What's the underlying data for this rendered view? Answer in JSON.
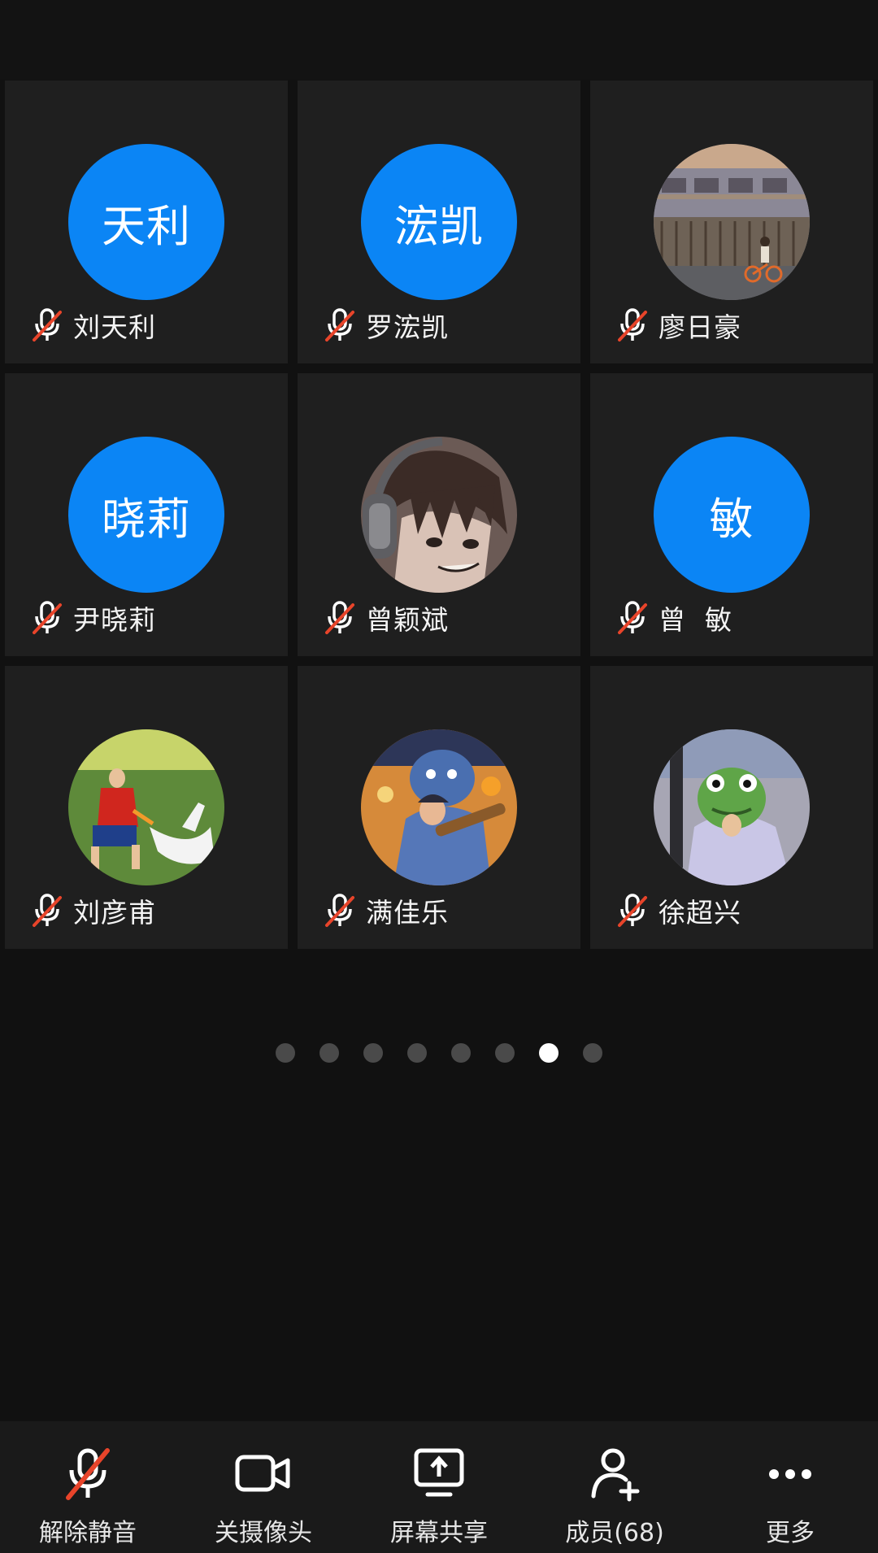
{
  "participants": [
    {
      "name": "刘天利",
      "avatar_text": "天利",
      "avatar_kind": "initials"
    },
    {
      "name": "罗浤凯",
      "avatar_text": "浤凯",
      "avatar_kind": "initials"
    },
    {
      "name": "廖日豪",
      "avatar_text": "",
      "avatar_kind": "photo-street"
    },
    {
      "name": "尹晓莉",
      "avatar_text": "晓莉",
      "avatar_kind": "initials"
    },
    {
      "name": "曾颖斌",
      "avatar_text": "",
      "avatar_kind": "photo-anime-headphones"
    },
    {
      "name": "曾  敏",
      "avatar_text": "敏",
      "avatar_kind": "initials"
    },
    {
      "name": "刘彦甫",
      "avatar_text": "",
      "avatar_kind": "photo-boy-goose"
    },
    {
      "name": "满佳乐",
      "avatar_text": "",
      "avatar_kind": "photo-game-character"
    },
    {
      "name": "徐超兴",
      "avatar_text": "",
      "avatar_kind": "photo-frog-mask"
    }
  ],
  "pagination": {
    "total_pages": 8,
    "current_page": 7
  },
  "toolbar": {
    "unmute": "解除静音",
    "camera_off": "关摄像头",
    "screen_share": "屏幕共享",
    "members": "成员(68)",
    "more": "更多"
  },
  "colors": {
    "background": "#111111",
    "tile": "#1f1f1f",
    "initials_avatar": "#0b85f5",
    "mute_slash": "#e8442a",
    "toolbar": "#1a1a1a"
  },
  "icons": {
    "participant_status": "mic-muted-icon",
    "unmute": "mic-muted-icon",
    "camera_off": "video-camera-icon",
    "screen_share": "screen-share-icon",
    "members": "add-person-icon",
    "more": "ellipsis-icon"
  }
}
